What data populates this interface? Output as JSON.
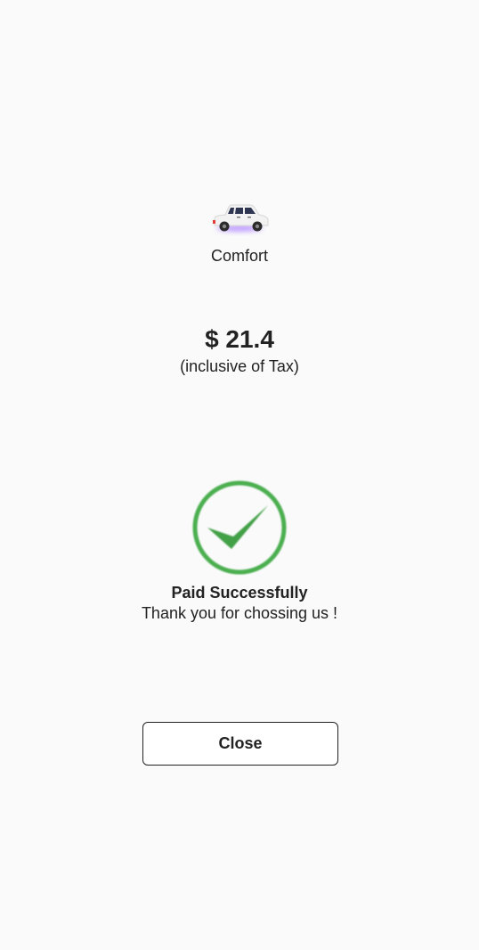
{
  "ride": {
    "vehicle_icon": "car-icon",
    "vehicle_name": "Comfort"
  },
  "fare": {
    "amount": "$ 21.4",
    "tax_note": "(inclusive of Tax)"
  },
  "status": {
    "icon": "check-circle-icon",
    "color": "#4caf50",
    "title": "Paid Successfully",
    "message": "Thank you for chossing us !"
  },
  "actions": {
    "close_label": "Close"
  },
  "colors": {
    "background": "#fafafa",
    "text": "#222222",
    "success": "#4caf50"
  }
}
